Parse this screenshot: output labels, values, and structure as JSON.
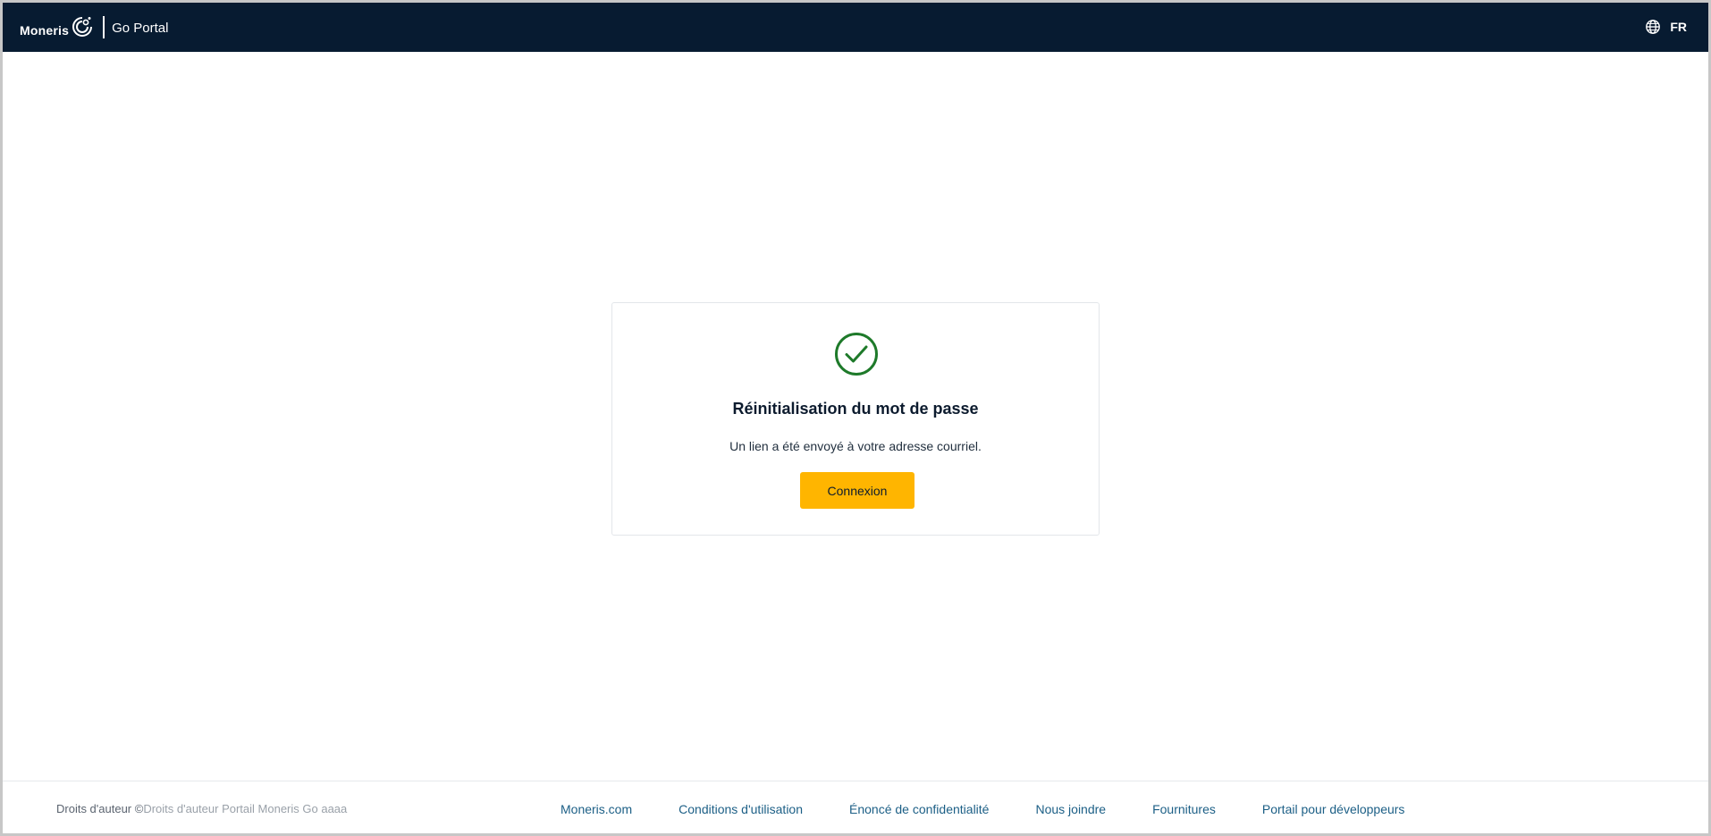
{
  "header": {
    "logo_text": "Moneris",
    "portal_name": "Go Portal",
    "language_label": "FR",
    "background_color": "#071b31"
  },
  "card": {
    "icon": "check-circle-icon",
    "icon_color": "#1e7a2a",
    "title": "Réinitialisation du mot de passe",
    "message": "Un lien a été envoyé à votre adresse courriel.",
    "button_label": "Connexion",
    "button_color": "#ffb500"
  },
  "footer": {
    "copyright_prefix": "Droits d'auteur ©",
    "copyright_rest": "Droits d'auteur Portail Moneris Go  aaaa",
    "links": [
      {
        "label": "Moneris.com"
      },
      {
        "label": "Conditions d'utilisation"
      },
      {
        "label": "Énoncé de confidentialité"
      },
      {
        "label": "Nous joindre"
      },
      {
        "label": "Fournitures"
      },
      {
        "label": "Portail pour développeurs"
      }
    ],
    "link_color": "#1c5f86"
  }
}
